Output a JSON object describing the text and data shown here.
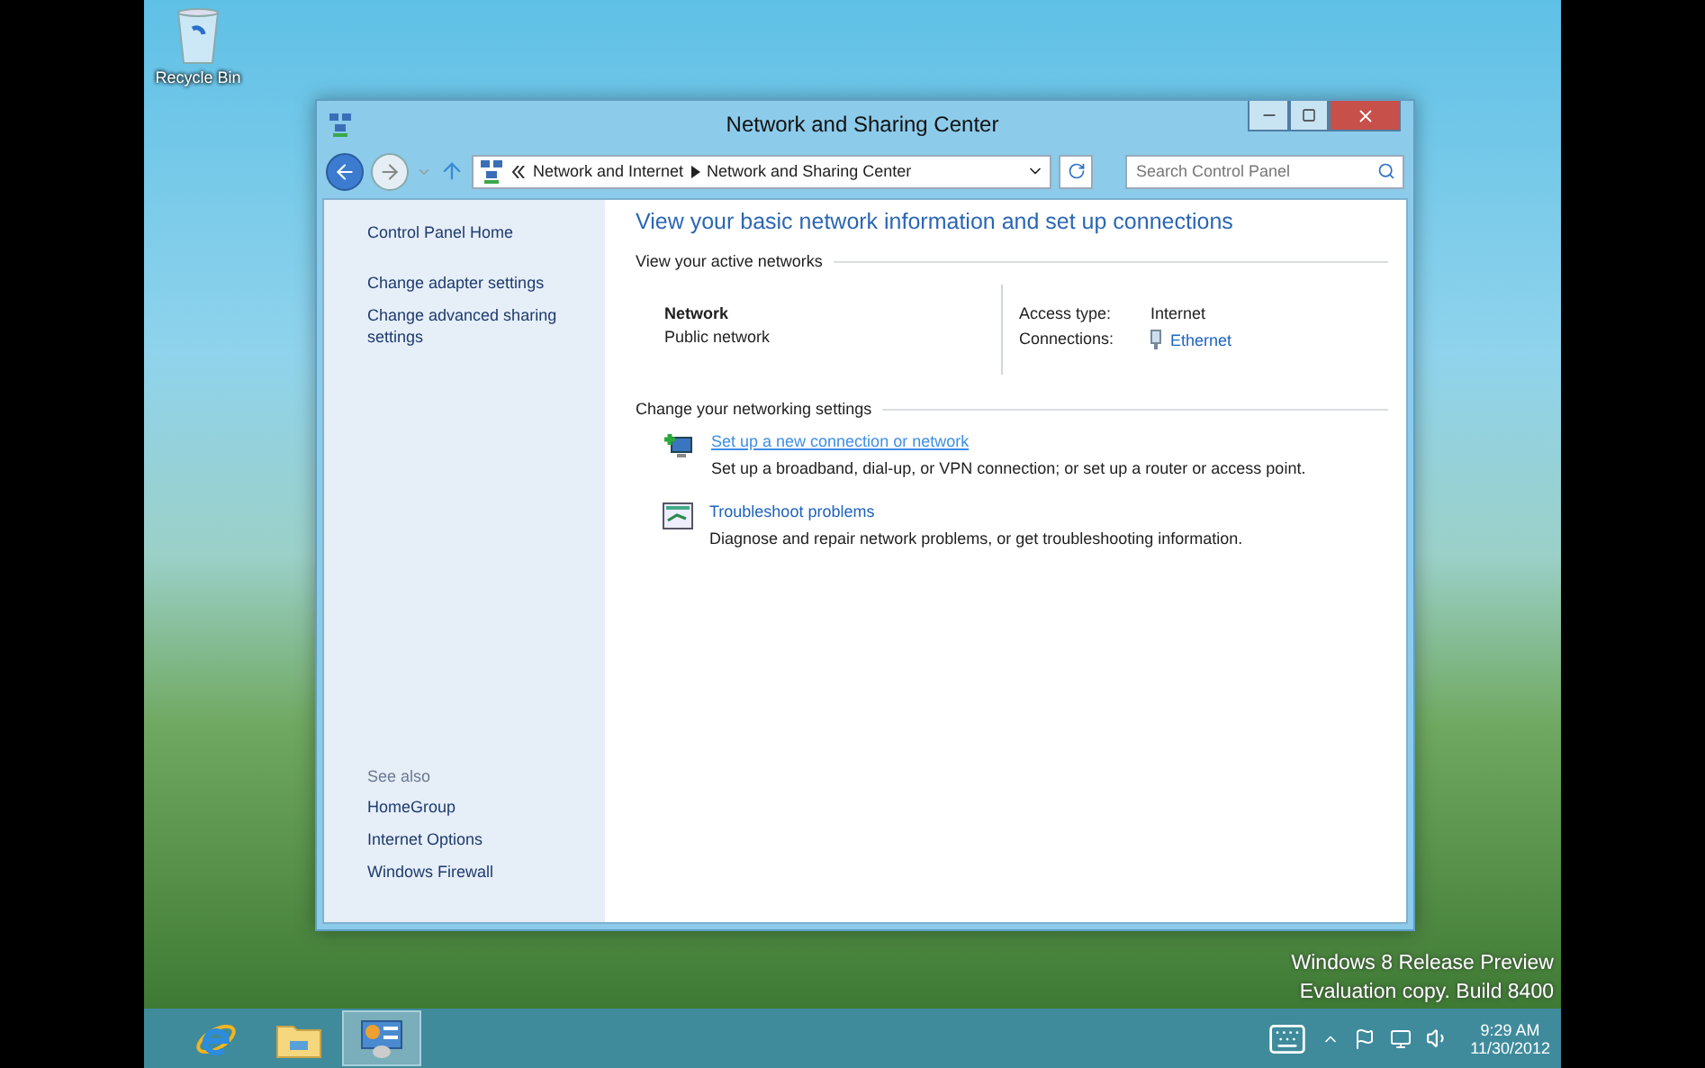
{
  "desktop": {
    "icons": [
      {
        "label": "Recycle Bin"
      }
    ],
    "watermark": [
      "Windows 8 Release Preview",
      "Evaluation copy. Build 8400"
    ]
  },
  "window": {
    "title": "Network and Sharing Center",
    "address": {
      "breadcrumbs": [
        "Network and Internet",
        "Network and Sharing Center"
      ]
    },
    "search": {
      "placeholder": "Search Control Panel"
    }
  },
  "sidebar": {
    "home": "Control Panel Home",
    "links": [
      "Change adapter settings",
      "Change advanced sharing settings"
    ],
    "see_also": {
      "heading": "See also",
      "links": [
        "HomeGroup",
        "Internet Options",
        "Windows Firewall"
      ]
    }
  },
  "main": {
    "heading": "View your basic network information and set up connections",
    "active_networks": {
      "heading": "View your active networks",
      "network": {
        "name": "Network",
        "category": "Public network"
      },
      "access_type": {
        "label": "Access type:",
        "value": "Internet"
      },
      "connections": {
        "label": "Connections:",
        "value": "Ethernet"
      }
    },
    "settings": {
      "heading": "Change your networking settings",
      "tasks": [
        {
          "kind": "new-connection",
          "link": "Set up a new connection or network",
          "description": "Set up a broadband, dial-up, or VPN connection; or set up a router or access point.",
          "hovered": true
        },
        {
          "kind": "troubleshoot",
          "link": "Troubleshoot problems",
          "description": "Diagnose and repair network problems, or get troubleshooting information.",
          "hovered": false
        }
      ]
    }
  },
  "taskbar": {
    "apps": [
      {
        "kind": "browser",
        "selected": false
      },
      {
        "kind": "explorer",
        "selected": false
      },
      {
        "kind": "control-panel",
        "selected": true
      }
    ],
    "tray": {
      "time": "9:29 AM",
      "date": "11/30/2012"
    }
  }
}
